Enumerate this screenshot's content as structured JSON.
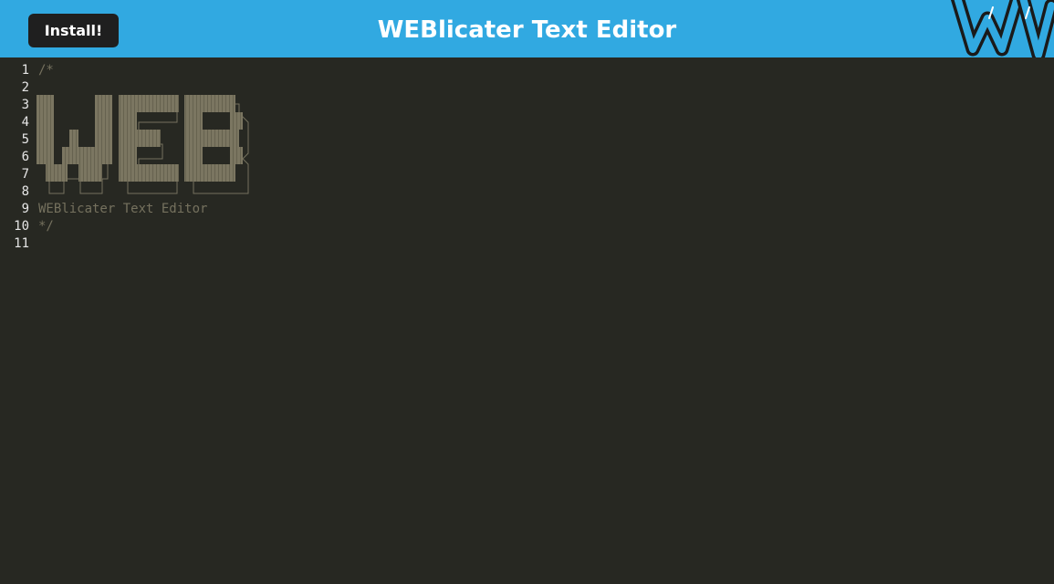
{
  "header": {
    "install_label": "Install!",
    "title": "WEBlicater Text Editor",
    "logo_icon": "w-logo-icon"
  },
  "colors": {
    "navbar": "#31a9e1",
    "editor_bg": "#272822",
    "comment": "#75715e",
    "gutter_text": "#e6e6e6",
    "button_bg": "#1f1f1f"
  },
  "editor": {
    "lines": [
      {
        "number": "1",
        "text": "/*"
      },
      {
        "number": "2",
        "text": ""
      },
      {
        "number": "3",
        "text": ""
      },
      {
        "number": "4",
        "text": ""
      },
      {
        "number": "5",
        "text": ""
      },
      {
        "number": "6",
        "text": ""
      },
      {
        "number": "7",
        "text": ""
      },
      {
        "number": "8",
        "text": ""
      },
      {
        "number": "9",
        "text": "WEBlicater Text Editor"
      },
      {
        "number": "10",
        "text": "*/"
      },
      {
        "number": "11",
        "text": ""
      }
    ],
    "ascii_art_word": "WEB"
  }
}
